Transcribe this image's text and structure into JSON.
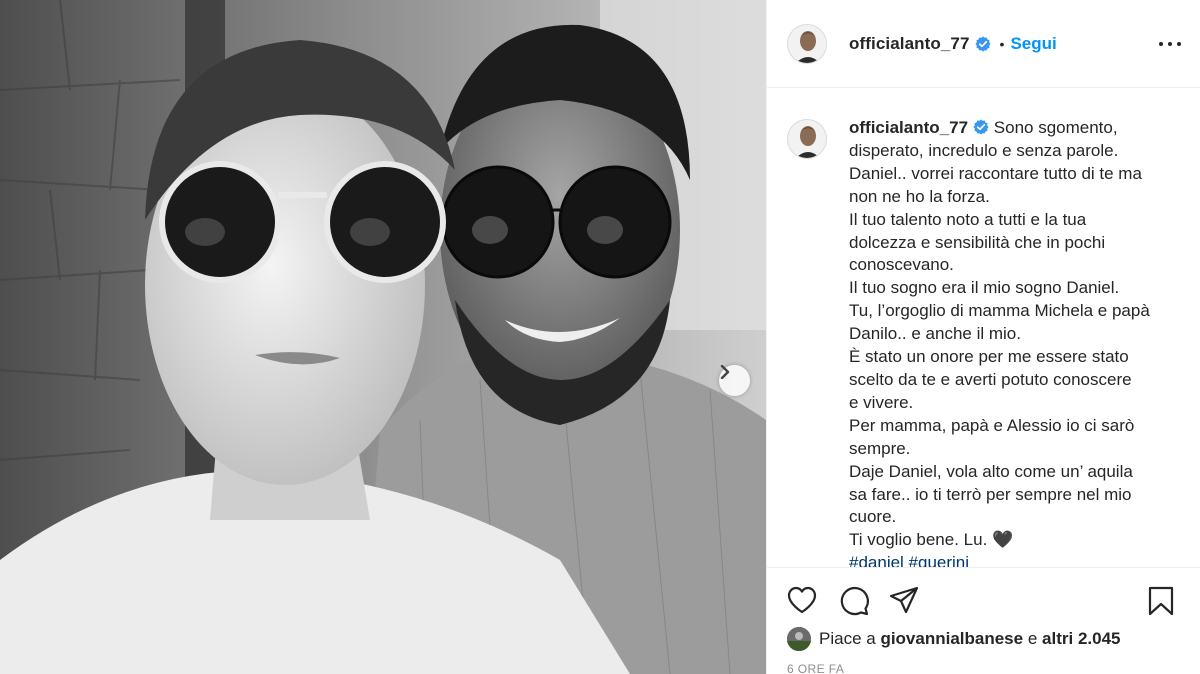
{
  "post": {
    "photo_alt": "",
    "carousel_next_icon": "chevron-right-icon"
  },
  "header": {
    "username": "officialanto_77",
    "verified_icon": "verified-badge-icon",
    "separator": "•",
    "follow_label": "Segui",
    "more_icon": "more-options-icon"
  },
  "caption": {
    "username": "officialanto_77",
    "lines": [
      "Sono sgomento,",
      "disperato, incredulo e senza parole.",
      "Daniel.. vorrei raccontare tutto di te ma",
      "non ne ho la forza.",
      "Il tuo talento noto a tutti e la tua",
      "dolcezza e sensibilità che in pochi",
      "conoscevano.",
      "Il tuo sogno era il mio sogno Daniel.",
      "Tu, l’orgoglio di mamma Michela e papà",
      "Danilo.. e anche il mio.",
      "È stato un onore per me essere stato",
      "scelto da te e averti potuto conoscere",
      "e vivere.",
      "Per mamma, papà e Alessio io ci sarò",
      "sempre.",
      "Daje Daniel, vola alto come un’ aquila",
      "sa fare.. io ti terrò per sempre nel mio",
      "cuore.",
      "Ti voglio bene. Lu. 🖤"
    ],
    "hashtags": "#daniel #guerini"
  },
  "actions": {
    "like_icon": "heart-icon",
    "comment_icon": "comment-icon",
    "share_icon": "send-icon",
    "save_icon": "bookmark-icon"
  },
  "likes": {
    "prefix": "Piace a",
    "user": "giovannialbanese",
    "middle": "e",
    "others": "altri 2.045"
  },
  "timestamp": "6 ORE FA",
  "colors": {
    "accent": "#0095f6",
    "text": "#262626",
    "muted": "#8e8e8e",
    "border": "#efefef",
    "hashtag": "#00376b"
  }
}
